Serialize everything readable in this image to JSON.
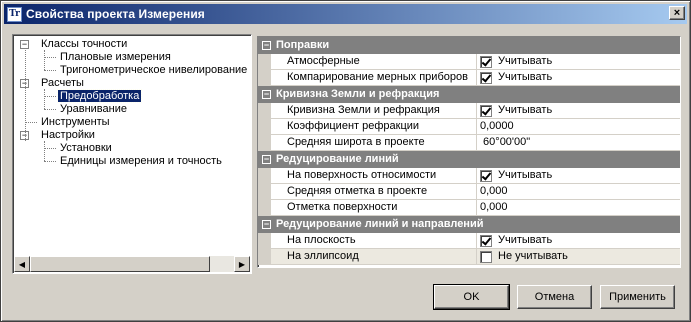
{
  "window": {
    "title": "Свойства проекта Измерения",
    "icon_text": "Tr",
    "close_label": "×"
  },
  "tree": {
    "items": [
      {
        "label": "Классы точности",
        "level": 0,
        "expanded": true
      },
      {
        "label": "Плановые измерения",
        "level": 1
      },
      {
        "label": "Тригонометрическое нивелирование",
        "level": 1
      },
      {
        "label": "Расчеты",
        "level": 0,
        "expanded": true
      },
      {
        "label": "Предобработка",
        "level": 1,
        "selected": true
      },
      {
        "label": "Уравнивание",
        "level": 1
      },
      {
        "label": "Инструменты",
        "level": 0
      },
      {
        "label": "Настройки",
        "level": 0,
        "expanded": true
      },
      {
        "label": "Установки",
        "level": 1
      },
      {
        "label": "Единицы измерения и точность",
        "level": 1
      }
    ],
    "expander_minus": "−"
  },
  "properties": {
    "categories": [
      {
        "title": "Поправки",
        "rows": [
          {
            "name": "Атмосферные",
            "checkbox": true,
            "checked": true,
            "value": "Учитывать"
          },
          {
            "name": "Компарирование мерных приборов",
            "checkbox": true,
            "checked": true,
            "value": "Учитывать"
          }
        ]
      },
      {
        "title": "Кривизна Земли и рефракция",
        "rows": [
          {
            "name": "Кривизна Земли и рефракция",
            "checkbox": true,
            "checked": true,
            "value": "Учитывать"
          },
          {
            "name": "Коэффициент рефракции",
            "checkbox": false,
            "value": "0,0000"
          },
          {
            "name": "Средняя широта в проекте",
            "checkbox": false,
            "value": " 60°00'00\""
          }
        ]
      },
      {
        "title": "Редуцирование линий",
        "rows": [
          {
            "name": "На поверхность относимости",
            "checkbox": true,
            "checked": true,
            "value": "Учитывать"
          },
          {
            "name": "Средняя отметка в проекте",
            "checkbox": false,
            "value": "0,000"
          },
          {
            "name": "Отметка поверхности",
            "checkbox": false,
            "value": "0,000"
          }
        ]
      },
      {
        "title": "Редуцирование линий и направлений",
        "rows": [
          {
            "name": "На плоскость",
            "checkbox": true,
            "checked": true,
            "value": "Учитывать"
          },
          {
            "name": "На эллипсоид",
            "checkbox": true,
            "checked": false,
            "value": "Не учитывать",
            "highlighted": true
          }
        ]
      }
    ],
    "collapse_glyph": "−"
  },
  "buttons": {
    "ok": "OK",
    "cancel": "Отмена",
    "apply": "Применить"
  },
  "scrollbar": {
    "left_arrow": "◀",
    "right_arrow": "▶"
  }
}
